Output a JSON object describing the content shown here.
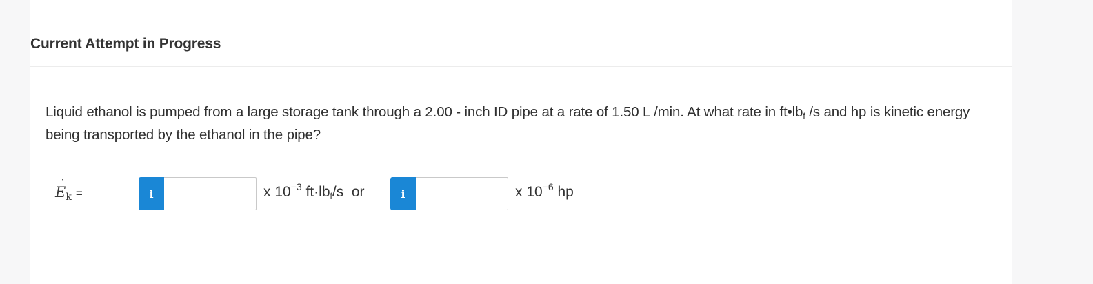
{
  "header": {
    "title": "Current Attempt in Progress"
  },
  "question": {
    "text_part1": "Liquid ethanol is pumped from a large storage tank through a 2.00 - inch ID pipe at a rate of 1.50 L /min. At what rate in ft•lb",
    "unit_sub": "f",
    "text_part2": " /s and hp is kinetic energy being transported by the ethanol in the pipe?"
  },
  "answer": {
    "label_symbol": "E",
    "label_sub": "k",
    "label_equals": "=",
    "info_icon_glyph": "i",
    "field1_value": "",
    "unit1_prefix": "x 10",
    "unit1_exp": "−3",
    "unit1_main": " ft·lb",
    "unit1_sub": "f",
    "unit1_suffix": "/s  or",
    "field2_value": "",
    "unit2_prefix": "x 10",
    "unit2_exp": "−6",
    "unit2_suffix": " hp"
  },
  "colors": {
    "info_button": "#1a87d6",
    "panel_bg": "#ffffff",
    "page_bg": "#f7f7f8"
  }
}
